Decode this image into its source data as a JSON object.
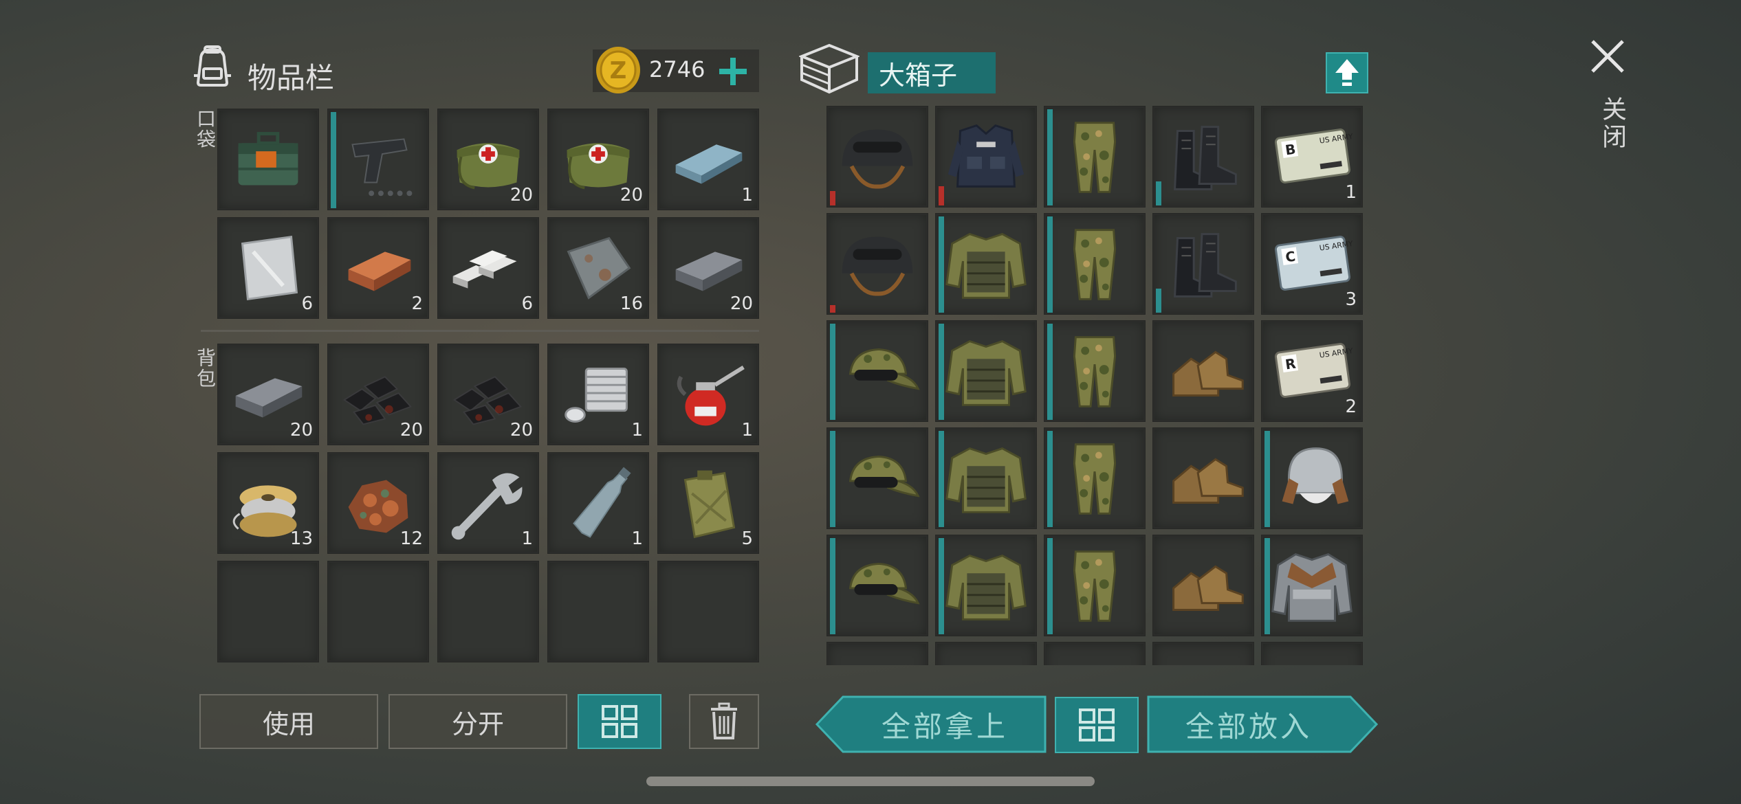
{
  "inventory": {
    "title": "物品栏",
    "coins": "2746",
    "add_icon": "plus-icon",
    "section_pockets": "口袋",
    "section_backpack": "背包",
    "pockets": [
      {
        "icon": "medkit-bag-icon",
        "count": ""
      },
      {
        "icon": "pistol-icon",
        "count": ""
      },
      {
        "icon": "field-medical-bag-icon",
        "count": "20"
      },
      {
        "icon": "field-medical-bag-icon",
        "count": "20"
      },
      {
        "icon": "steel-bar-icon",
        "count": "1"
      },
      {
        "icon": "aluminum-sheet-icon",
        "count": "6"
      },
      {
        "icon": "copper-ingot-icon",
        "count": "2"
      },
      {
        "icon": "silver-ingots-icon",
        "count": "6"
      },
      {
        "icon": "iron-plate-icon",
        "count": "16"
      },
      {
        "icon": "iron-ingot-icon",
        "count": "20"
      }
    ],
    "backpack": [
      {
        "icon": "iron-ingot-icon",
        "count": "20"
      },
      {
        "icon": "coal-icon",
        "count": "20"
      },
      {
        "icon": "coal-icon",
        "count": "20"
      },
      {
        "icon": "engine-cylinder-icon",
        "count": "1"
      },
      {
        "icon": "oil-can-icon",
        "count": "1"
      },
      {
        "icon": "wire-spool-icon",
        "count": "13"
      },
      {
        "icon": "copper-ore-icon",
        "count": "12"
      },
      {
        "icon": "wrench-icon",
        "count": "1"
      },
      {
        "icon": "plastic-bottle-icon",
        "count": "1"
      },
      {
        "icon": "jerry-can-icon",
        "count": "5"
      },
      {
        "icon": "",
        "count": ""
      },
      {
        "icon": "",
        "count": ""
      },
      {
        "icon": "",
        "count": ""
      },
      {
        "icon": "",
        "count": ""
      },
      {
        "icon": "",
        "count": ""
      }
    ],
    "buttons": {
      "use": "使用",
      "split": "分开",
      "sort_icon": "grid-sort-icon",
      "delete_icon": "trash-icon"
    }
  },
  "container": {
    "title": "大箱子",
    "upload_icon": "upload-arrow-icon",
    "items": [
      {
        "icon": "military-helmet-icon",
        "count": "",
        "bar": "red",
        "bar_level": 0.15
      },
      {
        "icon": "police-vest-icon",
        "count": "",
        "bar": "red",
        "bar_level": 0.2
      },
      {
        "icon": "camo-pants-icon",
        "count": "",
        "bar": "teal",
        "bar_level": 1.0
      },
      {
        "icon": "combat-boots-icon",
        "count": "",
        "bar": "teal",
        "bar_level": 0.25
      },
      {
        "icon": "keycard-b-icon",
        "count": "1",
        "bar": "",
        "bar_level": 0
      },
      {
        "icon": "military-helmet-icon",
        "count": "",
        "bar": "red",
        "bar_level": 0.08
      },
      {
        "icon": "camo-jacket-icon",
        "count": "",
        "bar": "teal",
        "bar_level": 1.0
      },
      {
        "icon": "camo-pants-icon",
        "count": "",
        "bar": "teal",
        "bar_level": 1.0
      },
      {
        "icon": "combat-boots-icon",
        "count": "",
        "bar": "teal",
        "bar_level": 0.25
      },
      {
        "icon": "keycard-c-icon",
        "count": "3",
        "bar": "",
        "bar_level": 0
      },
      {
        "icon": "camo-cap-icon",
        "count": "",
        "bar": "teal",
        "bar_level": 1.0
      },
      {
        "icon": "camo-jacket-icon",
        "count": "",
        "bar": "teal",
        "bar_level": 1.0
      },
      {
        "icon": "camo-pants-icon",
        "count": "",
        "bar": "teal",
        "bar_level": 1.0
      },
      {
        "icon": "leather-boots-icon",
        "count": "",
        "bar": "",
        "bar_level": 0
      },
      {
        "icon": "keycard-r-icon",
        "count": "2",
        "bar": "",
        "bar_level": 0
      },
      {
        "icon": "camo-cap-icon",
        "count": "",
        "bar": "teal",
        "bar_level": 1.0
      },
      {
        "icon": "camo-jacket-icon",
        "count": "",
        "bar": "teal",
        "bar_level": 1.0
      },
      {
        "icon": "camo-pants-icon",
        "count": "",
        "bar": "teal",
        "bar_level": 1.0
      },
      {
        "icon": "leather-boots-icon",
        "count": "",
        "bar": "",
        "bar_level": 0
      },
      {
        "icon": "winter-hat-icon",
        "count": "",
        "bar": "teal",
        "bar_level": 1.0
      },
      {
        "icon": "camo-cap-icon",
        "count": "",
        "bar": "teal",
        "bar_level": 1.0
      },
      {
        "icon": "camo-jacket-icon",
        "count": "",
        "bar": "teal",
        "bar_level": 1.0
      },
      {
        "icon": "camo-pants-icon",
        "count": "",
        "bar": "teal",
        "bar_level": 1.0
      },
      {
        "icon": "leather-boots-icon",
        "count": "",
        "bar": "",
        "bar_level": 0
      },
      {
        "icon": "leather-jacket-icon",
        "count": "",
        "bar": "teal",
        "bar_level": 1.0
      }
    ],
    "buttons": {
      "take_all": "全部拿上",
      "sort_icon": "grid-sort-icon",
      "put_all": "全部放入"
    }
  },
  "close": {
    "icon": "close-icon",
    "label": "关闭"
  },
  "colors": {
    "accent": "#1f7f80",
    "slot": "#323431",
    "durability_red": "#b6302a",
    "durability_teal": "#2c8f8f"
  }
}
